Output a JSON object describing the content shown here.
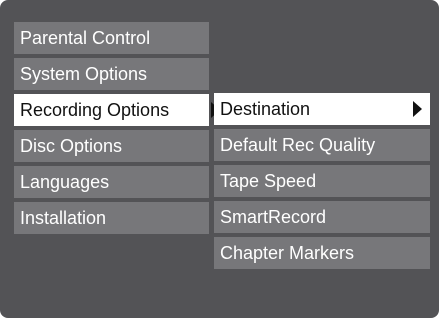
{
  "main_menu": {
    "items": [
      {
        "label": "Parental Control"
      },
      {
        "label": "System Options"
      },
      {
        "label": "Recording Options",
        "selected": true
      },
      {
        "label": "Disc Options"
      },
      {
        "label": "Languages"
      },
      {
        "label": "Installation"
      }
    ]
  },
  "submenu": {
    "items": [
      {
        "label": "Destination",
        "selected": true
      },
      {
        "label": "Default Rec Quality"
      },
      {
        "label": "Tape Speed"
      },
      {
        "label": "SmartRecord"
      },
      {
        "label": "Chapter Markers"
      }
    ]
  },
  "icons": {
    "submenu_arrow": "triangle-right-icon"
  },
  "colors": {
    "screen_background": "#535356",
    "item_background": "#77777a",
    "selected_background": "#ffffff",
    "item_text": "#ffffff",
    "selected_text": "#111111"
  }
}
